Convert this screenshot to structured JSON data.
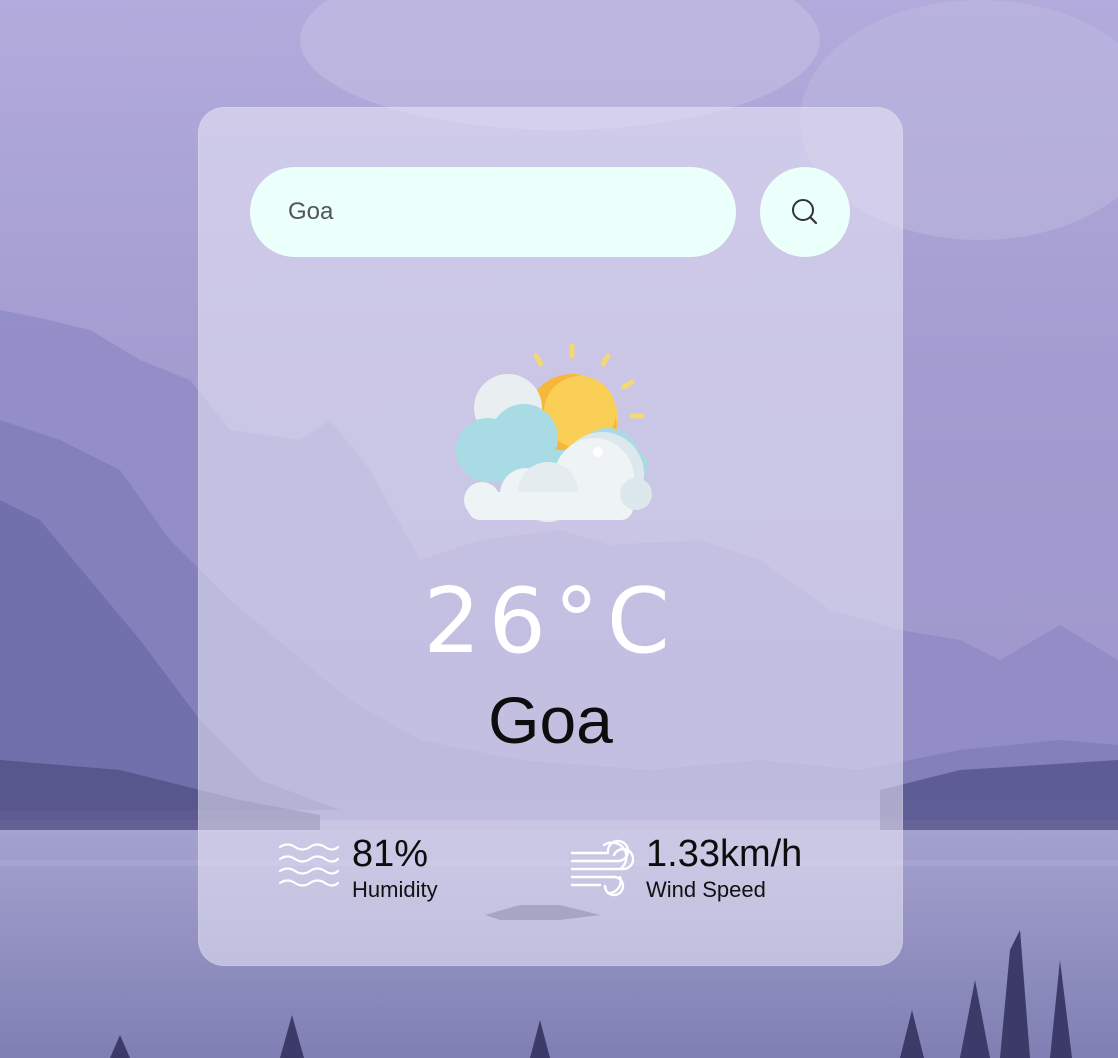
{
  "search": {
    "value": "Goa",
    "button_icon": "search-icon"
  },
  "weather": {
    "icon": "partly-cloudy-sun-icon",
    "temperature": "26°C",
    "city": "Goa"
  },
  "details": {
    "humidity": {
      "icon": "humidity-waves-icon",
      "value": "81%",
      "label": "Humidity"
    },
    "wind": {
      "icon": "wind-icon",
      "value": "1.33km/h",
      "label": "Wind Speed"
    }
  },
  "colors": {
    "input_background": "#ebfffb",
    "temperature_text": "#ffffff",
    "city_text": "#0d0d0d",
    "sun": "#f7c24a",
    "cloud_blue": "#a8dbe3",
    "cloud_white": "#eef3f6"
  }
}
